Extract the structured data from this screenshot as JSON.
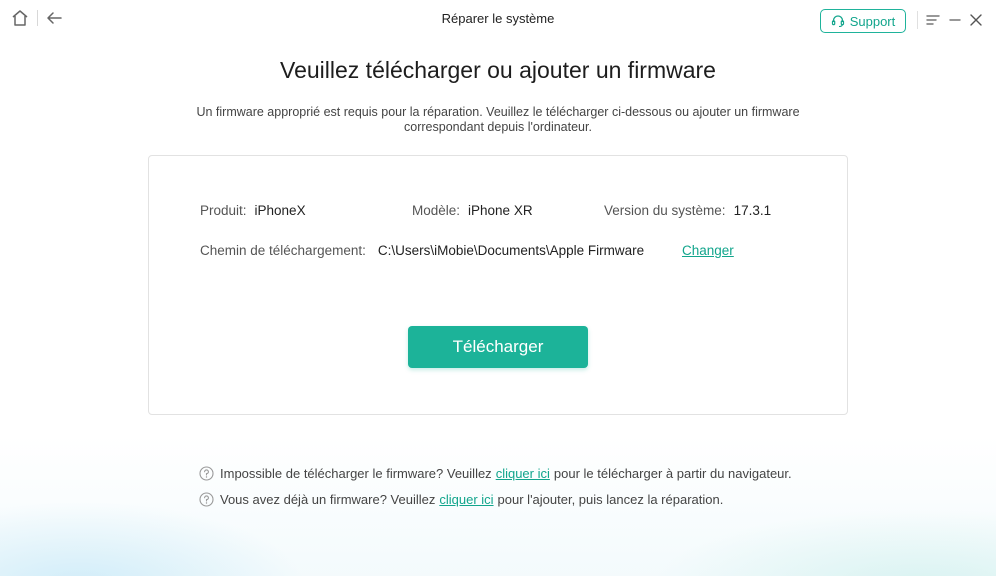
{
  "window": {
    "title": "Réparer le système",
    "support_label": "Support"
  },
  "main": {
    "heading": "Veuillez télécharger ou ajouter un firmware",
    "subtext_line1": "Un firmware approprié est requis pour la réparation. Veuillez le télécharger ci-dessous ou ajouter un firmware",
    "subtext_line2": "correspondant depuis l'ordinateur."
  },
  "device": {
    "product_label": "Produit:",
    "product_value": "iPhoneX",
    "model_label": "Modèle:",
    "model_value": "iPhone XR",
    "version_label": "Version du système:",
    "version_value": "17.3.1",
    "path_label": "Chemin de téléchargement:",
    "path_value": "C:\\Users\\iMobie\\Documents\\Apple Firmware",
    "change_label": "Changer"
  },
  "actions": {
    "download_label": "Télécharger"
  },
  "help": {
    "line1_before": "Impossible de télécharger le firmware? Veuillez",
    "line1_link": "cliquer ici",
    "line1_after": "pour le télécharger à partir du navigateur.",
    "line2_before": "Vous avez déjà un firmware? Veuillez",
    "line2_link": "cliquer ici",
    "line2_after": "pour l'ajouter, puis lancez la réparation."
  },
  "colors": {
    "accent": "#1cb399",
    "link": "#12a58c"
  },
  "icons": {
    "home": "home-icon",
    "back": "back-arrow-icon",
    "support": "headset-icon",
    "menu": "menu-icon",
    "minimize": "minimize-icon",
    "close": "close-icon",
    "help": "question-circle-icon"
  }
}
